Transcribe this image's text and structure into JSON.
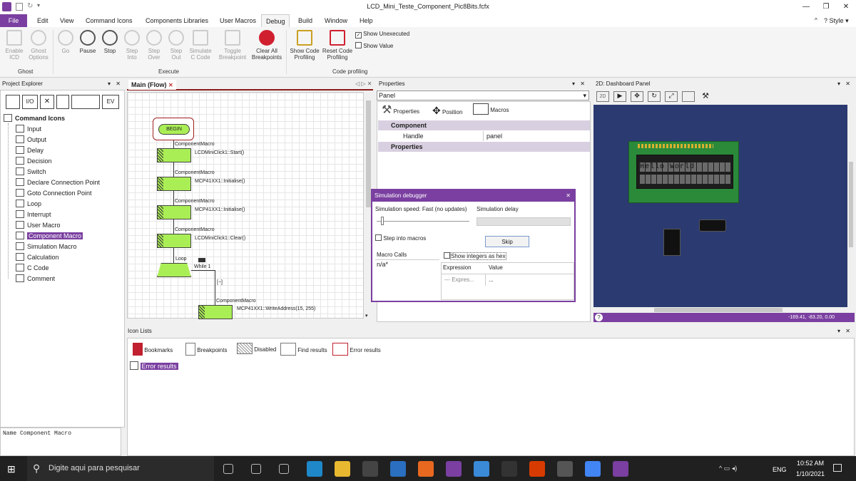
{
  "window": {
    "title": "LCD_Mini_Teste_Component_Pic8Bits.fcfx",
    "style_label": "Style"
  },
  "menu": [
    "File",
    "Edit",
    "View",
    "Command Icons",
    "Components Libraries",
    "User Macros",
    "Debug",
    "Build",
    "Window",
    "Help"
  ],
  "ribbon": {
    "ghost": [
      {
        "label": "Enable ICD"
      },
      {
        "label": "Ghost Options"
      }
    ],
    "ghost_group": "Ghost",
    "execute": [
      {
        "label": "Go"
      },
      {
        "label": "Pause"
      },
      {
        "label": "Stop"
      },
      {
        "label": "Step Into"
      },
      {
        "label": "Step Over"
      },
      {
        "label": "Step Out"
      },
      {
        "label": "Simulate C Code"
      },
      {
        "label": "Toggle Breakpoint"
      },
      {
        "label": "Clear All Breakpoints"
      }
    ],
    "execute_group": "Execute",
    "profiling": [
      {
        "label": "Show Code Profiling"
      },
      {
        "label": "Reset Code Profiling"
      }
    ],
    "show_unexecuted": "Show Unexecuted",
    "show_value": "Show Value",
    "profiling_group": "Code profiling"
  },
  "project_explorer": {
    "title": "Project Explorer",
    "root": "Command Icons",
    "items": [
      "Input",
      "Output",
      "Delay",
      "Decision",
      "Switch",
      "Declare Connection Point",
      "Goto Connection Point",
      "Loop",
      "Interrupt",
      "User Macro",
      "Component Macro",
      "Simulation Macro",
      "Calculation",
      "C Code",
      "Comment"
    ],
    "selected": "Component Macro",
    "description": "Name Component Macro"
  },
  "flow": {
    "tab": "Main (Flow)",
    "begin": "BEGIN",
    "macros": [
      {
        "type": "ComponentMacro",
        "call": "LCDMiniClick1::Start()"
      },
      {
        "type": "ComponentMacro",
        "call": "MCP41XX1::Initialise()"
      },
      {
        "type": "ComponentMacro",
        "call": "MCP41XX1::Initialise()"
      },
      {
        "type": "ComponentMacro",
        "call": "LCDMiniClick1::Clear()"
      }
    ],
    "loop_label": "Loop",
    "loop_cond": "While 1",
    "loop_mark": "[~]",
    "last_macro": {
      "type": "ComponentMacro",
      "call": "MCP41XX1::WriteAddress(15, 255)"
    }
  },
  "properties": {
    "title": "Properties",
    "selector": "Panel",
    "tabs": [
      "Properties",
      "Position",
      "Macros"
    ],
    "section_component": "Component",
    "handle_key": "Handle",
    "handle_value": "panel",
    "section_properties": "Properties"
  },
  "simdebug": {
    "title": "Simulation debugger",
    "speed": "Simulation speed: Fast (no updates)",
    "delay": "Simulation delay",
    "step_into": "Step into macros",
    "skip": "Skip",
    "macro_calls": "Macro Calls",
    "macro_value": "n/a*",
    "hex": "Show integers as hex",
    "col_expr": "Expression",
    "col_value": "Value",
    "row_expr": "--- Expres...",
    "row_value": "..."
  },
  "dashboard": {
    "title": "2D: Dashboard Panel",
    "lcd_text": "Hello World",
    "coords": "-169.41, -83.20, 0.00",
    "mode": "2D"
  },
  "iconlists": {
    "title": "Icon Lists",
    "tabs": [
      "Bookmarks",
      "Breakpoints",
      "Disabled",
      "Find results",
      "Error results"
    ],
    "section": "Error results"
  },
  "taskbar": {
    "search": "Digite aqui para pesquisar",
    "lang": "ENG",
    "time": "10:52 AM",
    "date": "1/10/2021"
  },
  "colors": {
    "accent": "#7a3fa0",
    "dash_bg": "#2b3a70",
    "lcd_green": "#2a8a3a",
    "macro_green": "#aaee55"
  }
}
